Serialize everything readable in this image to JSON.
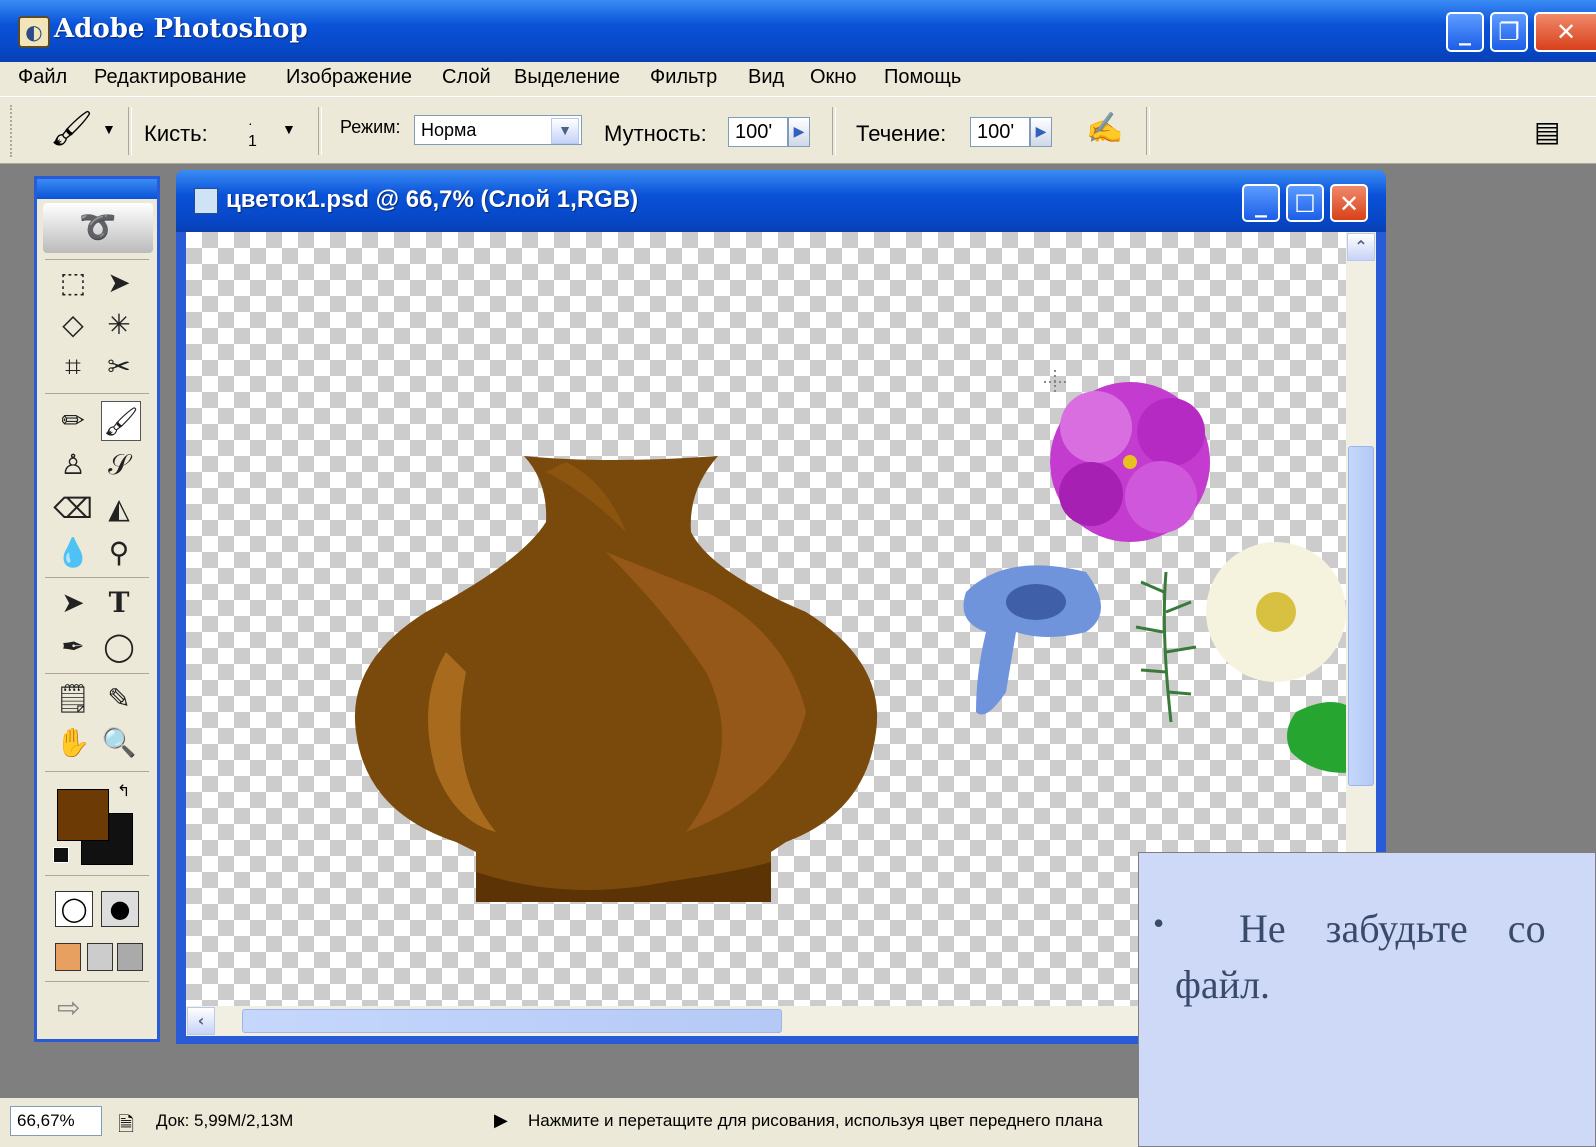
{
  "app": {
    "title": "Adobe Photoshop"
  },
  "menu": [
    "Файл",
    "Редактирование",
    "Изображение",
    "Слой",
    "Выделение",
    "Фильтр",
    "Вид",
    "Окно",
    "Помощь"
  ],
  "options": {
    "brush_label": "Кисть:",
    "brush_size": "1",
    "mode_label": "Режим:",
    "mode_value": "Норма",
    "opacity_label": "Мутность:",
    "opacity_value": "100'",
    "flow_label": "Течение:",
    "flow_value": "100'"
  },
  "document": {
    "title": "цветок1.psd @ 66,7% (Слой 1,RGB)"
  },
  "status": {
    "zoom": "66,67%",
    "doc_size": "Док: 5,99M/2,13M",
    "hint": "Нажмите и перетащите для рисования, используя цвет переднего плана"
  },
  "note": {
    "line1": "Не забудьте со",
    "line2": "файл."
  },
  "colors": {
    "foreground": "#6b3a05",
    "background": "#111111",
    "note_bg": "#cdd9f7"
  }
}
